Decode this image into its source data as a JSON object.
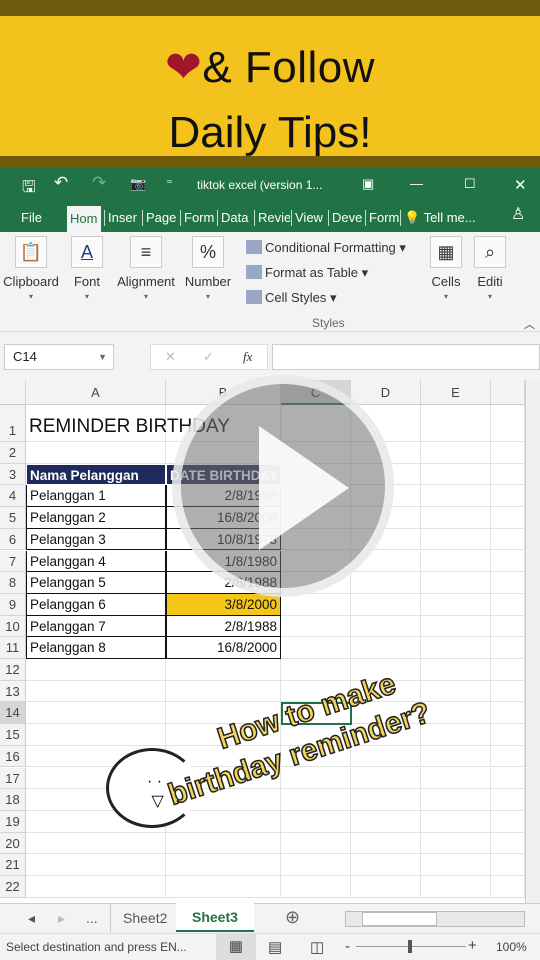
{
  "banner": {
    "line1_heart": "❤",
    "line1": "& Follow",
    "line2": "Daily Tips!"
  },
  "colors": {
    "banner": "#f4c21c",
    "excel_green": "#217346",
    "header_fill": "#1f2a5c",
    "highlight": "#f5c518"
  },
  "titlebar": {
    "title": "tiktok excel (version 1...",
    "save": "🖫",
    "undo": "↶",
    "redo": "↷",
    "camera": "📷",
    "customize": "⁼",
    "ribbon_display": "▣",
    "minimize": "—",
    "maximize": "☐",
    "close": "✕"
  },
  "tabs": [
    {
      "label": "File"
    },
    {
      "label": "Hom"
    },
    {
      "label": "Inser"
    },
    {
      "label": "Page"
    },
    {
      "label": "Form"
    },
    {
      "label": "Data"
    },
    {
      "label": "Revie"
    },
    {
      "label": "View"
    },
    {
      "label": "Deve"
    },
    {
      "label": "Form"
    }
  ],
  "tell_me": "Tell me...",
  "ribbon": {
    "groups": [
      {
        "label": "Clipboard",
        "icon": "📋"
      },
      {
        "label": "Font",
        "icon": "A"
      },
      {
        "label": "Alignment",
        "icon": "≡"
      },
      {
        "label": "Number",
        "icon": "%"
      },
      {
        "label": "Cells",
        "icon": "▦"
      },
      {
        "label": "Editi",
        "icon": "⌕"
      }
    ],
    "styles": {
      "items": [
        "Conditional Formatting ▾",
        "Format as Table ▾",
        "Cell Styles ▾"
      ],
      "label": "Styles"
    }
  },
  "formula_bar": {
    "name_box": "C14",
    "cancel": "✕",
    "enter": "✓",
    "fx": "fx",
    "value": ""
  },
  "columns": [
    "A",
    "B",
    "C",
    "D",
    "E"
  ],
  "rows": [
    "1",
    "2",
    "3",
    "4",
    "5",
    "6",
    "7",
    "8",
    "9",
    "10",
    "11",
    "12",
    "13",
    "14",
    "15",
    "16",
    "17",
    "18",
    "19",
    "20",
    "21",
    "22"
  ],
  "sheet": {
    "title": "REMINDER BIRTHDAY",
    "headers": [
      "Nama Pelanggan",
      "DATE BIRTHDAY"
    ],
    "data": [
      [
        "Pelanggan 1",
        "2/8/1988"
      ],
      [
        "Pelanggan 2",
        "16/8/2000"
      ],
      [
        "Pelanggan 3",
        "10/8/1978"
      ],
      [
        "Pelanggan 4",
        "1/8/1980"
      ],
      [
        "Pelanggan 5",
        "2/8/1988"
      ],
      [
        "Pelanggan 6",
        "3/8/2000"
      ],
      [
        "Pelanggan 7",
        "2/8/1988"
      ],
      [
        "Pelanggan 8",
        "16/8/2000"
      ]
    ],
    "selected_cell": "C14",
    "highlighted_row": "Pelanggan 6"
  },
  "sheet_tabs": {
    "prev": "◂",
    "next": "▸",
    "more": "...",
    "tabs": [
      "Sheet2",
      "Sheet3"
    ],
    "active": "Sheet3",
    "add": "⊕"
  },
  "status": {
    "text": "Select destination and press EN...",
    "zoom": "100%",
    "minus": "-",
    "plus": "+"
  },
  "overlay": {
    "caption_line1": "How to make",
    "caption_line2": "birthday reminder?"
  }
}
